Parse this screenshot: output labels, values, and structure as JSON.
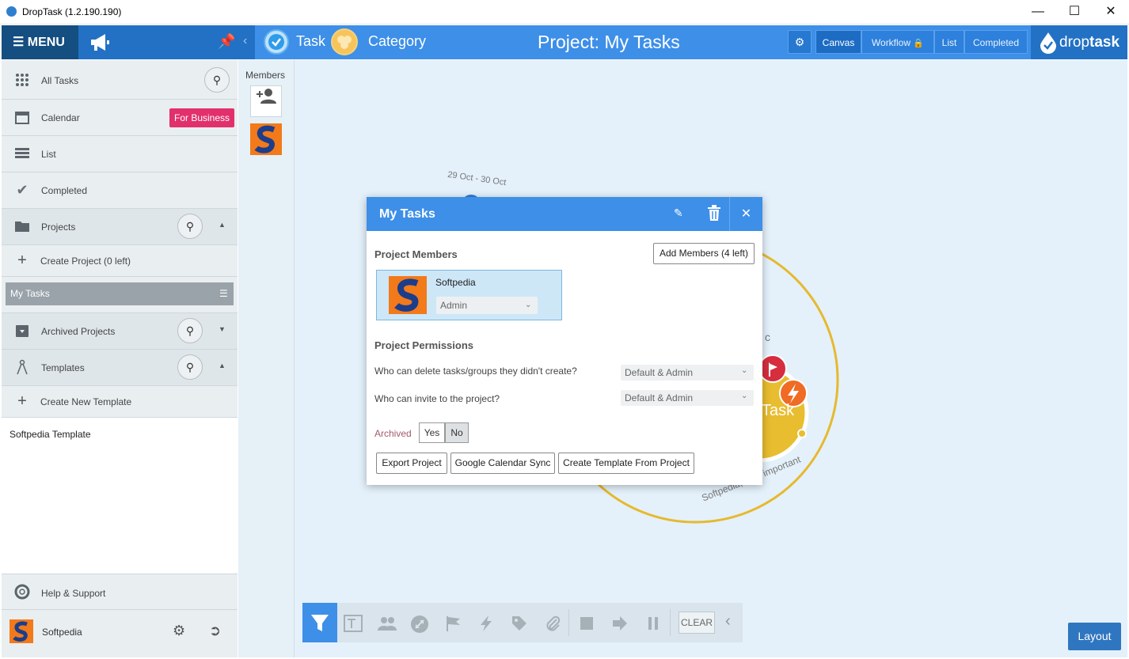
{
  "window": {
    "title": "DropTask (1.2.190.190)"
  },
  "header": {
    "menu_label": "☰ MENU",
    "task_label": "Task",
    "category_label": "Category",
    "project_title": "Project: My Tasks",
    "view_tabs": [
      "Canvas",
      "Workflow",
      "List",
      "Completed"
    ],
    "logo_text_a": "drop",
    "logo_text_b": "task"
  },
  "sidebar": {
    "items": [
      {
        "label": "All Tasks"
      },
      {
        "label": "Calendar"
      },
      {
        "label": "List"
      },
      {
        "label": "Completed"
      },
      {
        "label": "Projects"
      },
      {
        "label": "Create Project (0 left)"
      },
      {
        "label": "Archived Projects"
      },
      {
        "label": "Templates"
      },
      {
        "label": "Create New Template"
      }
    ],
    "for_business": "For Business",
    "selected_project": "My Tasks",
    "template_item": "Softpedia Template",
    "help": "Help & Support",
    "user": "Softpedia"
  },
  "members_panel": {
    "title": "Members"
  },
  "canvas": {
    "date_label": "29 Oct - 30 Oct",
    "task_label": "Task",
    "tags_label": "Softpedia, test, important",
    "c_label": "c"
  },
  "modal": {
    "title": "My Tasks",
    "members_heading": "Project Members",
    "add_members": "Add Members (4 left)",
    "member_name": "Softpedia",
    "member_role": "Admin",
    "permissions_heading": "Project Permissions",
    "perm1_q": "Who can delete tasks/groups they didn't create?",
    "perm1_val": "Default & Admin",
    "perm2_q": "Who can invite to the project?",
    "perm2_val": "Default & Admin",
    "archived_label": "Archived",
    "yes": "Yes",
    "no": "No",
    "export": "Export Project",
    "gcal": "Google Calendar Sync",
    "template": "Create Template From Project"
  },
  "bottom": {
    "clear": "CLEAR",
    "layout": "Layout"
  },
  "colors": {
    "accent": "#3d8fe8",
    "header_dark": "#154e80",
    "business": "#e1306c",
    "circle": "#e6b92e"
  }
}
